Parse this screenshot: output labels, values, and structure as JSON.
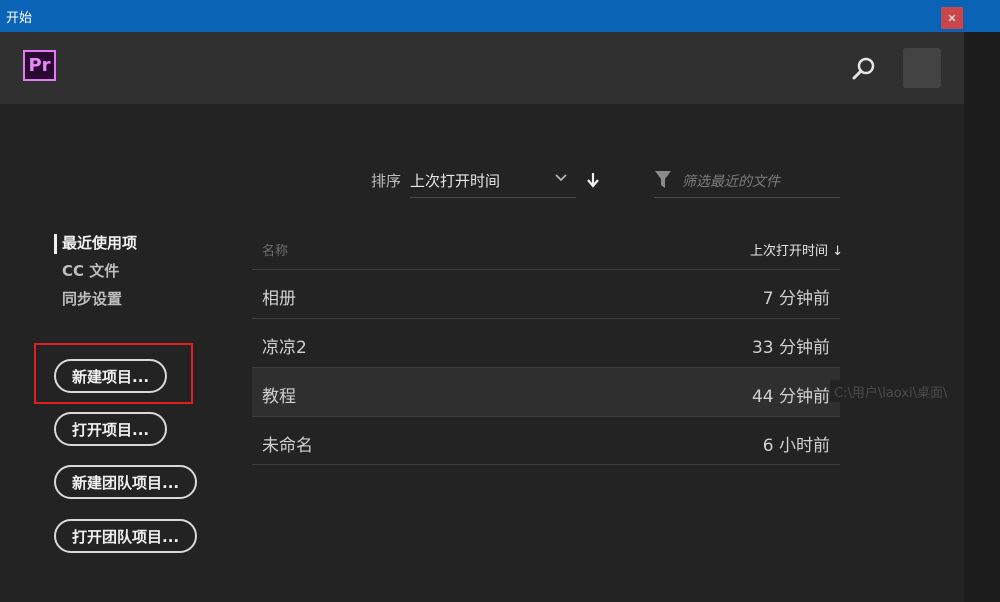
{
  "window": {
    "title": "开始",
    "close_label": "✕"
  },
  "header": {
    "logo_text": "Pr",
    "search_icon": "search-icon",
    "avatar": "avatar"
  },
  "toolbar": {
    "sort_label": "排序",
    "sort_value": "上次打开时间",
    "filter_placeholder": "筛选最近的文件"
  },
  "sidebar": {
    "items": [
      {
        "label": "最近使用项",
        "active": true
      },
      {
        "label": "CC 文件",
        "active": false
      },
      {
        "label": "同步设置",
        "active": false
      }
    ]
  },
  "buttons": {
    "new_project": "新建项目...",
    "open_project": "打开项目...",
    "new_team_project": "新建团队项目...",
    "open_team_project": "打开团队项目..."
  },
  "table": {
    "col_name": "名称",
    "col_time": "上次打开时间 ↓",
    "rows": [
      {
        "name": "相册",
        "time": "7 分钟前"
      },
      {
        "name": "凉凉2",
        "time": "33 分钟前"
      },
      {
        "name": "教程",
        "time": "44 分钟前"
      },
      {
        "name": "未命名",
        "time": "6 小时前"
      }
    ],
    "tooltip": "C:\\用户\\laoxi\\桌面\\"
  },
  "colors": {
    "titlebar": "#0a63b4",
    "accent_pr": "#e07bf0",
    "highlight": "#e02020",
    "background": "#232323"
  }
}
